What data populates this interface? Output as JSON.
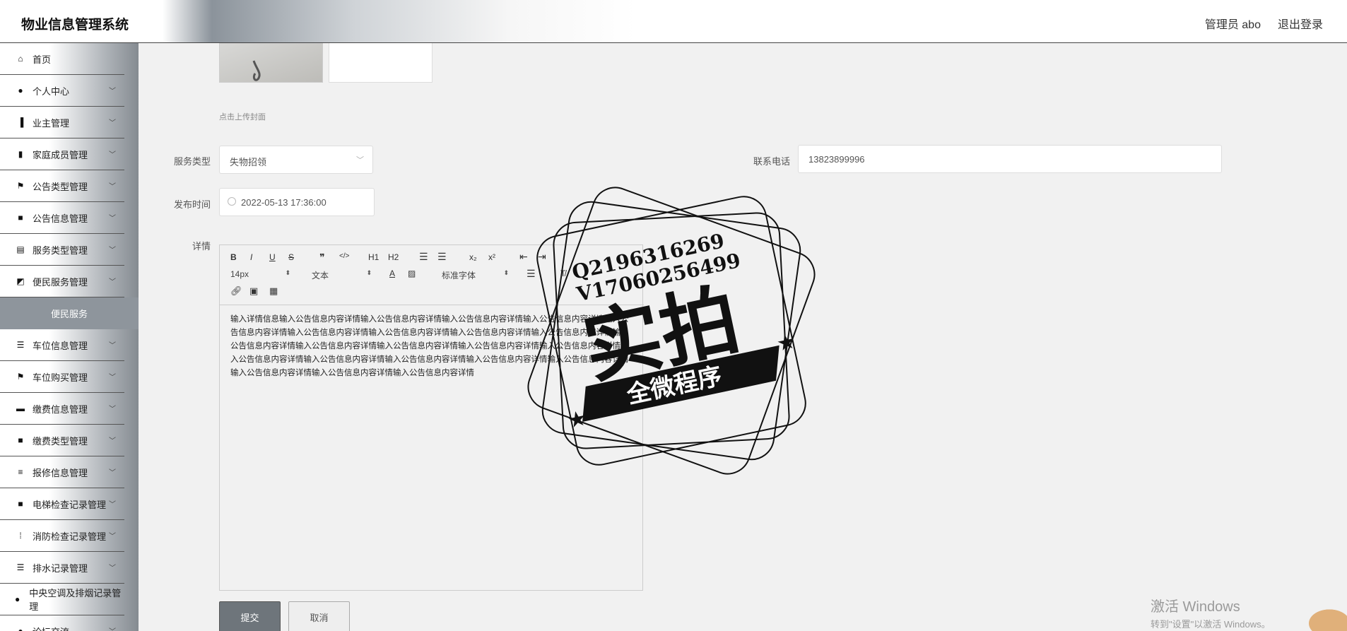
{
  "header": {
    "title": "物业信息管理系统",
    "user": "管理员 abo",
    "logout": "退出登录"
  },
  "sidebar": {
    "items": [
      {
        "label": "首页",
        "icon": "home-icon"
      },
      {
        "label": "个人中心",
        "icon": "user-icon"
      },
      {
        "label": "业主管理",
        "icon": "building-icon"
      },
      {
        "label": "家庭成员管理",
        "icon": "bar-chart-icon"
      },
      {
        "label": "公告类型管理",
        "icon": "flag-icon"
      },
      {
        "label": "公告信息管理",
        "icon": "grid-icon"
      },
      {
        "label": "服务类型管理",
        "icon": "clipboard-icon"
      },
      {
        "label": "便民服务管理",
        "icon": "chart-icon"
      },
      {
        "label": "便民服务",
        "icon": ""
      },
      {
        "label": "车位信息管理",
        "icon": "list-icon"
      },
      {
        "label": "车位购买管理",
        "icon": "flag-icon"
      },
      {
        "label": "缴费信息管理",
        "icon": "ticket-icon"
      },
      {
        "label": "缴费类型管理",
        "icon": "grid-icon"
      },
      {
        "label": "报修信息管理",
        "icon": "sliders-icon"
      },
      {
        "label": "电梯检查记录管理",
        "icon": "grid-icon"
      },
      {
        "label": "消防检查记录管理",
        "icon": "dots-grid-icon"
      },
      {
        "label": "排水记录管理",
        "icon": "list-icon"
      },
      {
        "label": "中央空调及排烟记录管理",
        "icon": "pin-icon"
      },
      {
        "label": "论坛交流",
        "icon": "user-icon"
      }
    ]
  },
  "form": {
    "upload_hint": "点击上传封面",
    "service_type": {
      "label": "服务类型",
      "value": "失物招领"
    },
    "phone": {
      "label": "联系电话",
      "value": "13823899996"
    },
    "publish_time": {
      "label": "发布时间",
      "value": "2022-05-13 17:36:00"
    },
    "detail": {
      "label": "详情"
    }
  },
  "editor": {
    "toolbar": {
      "bold": "B",
      "italic": "I",
      "underline": "U",
      "strike": "S",
      "quote": "❞",
      "code": "</>",
      "h1": "H1",
      "h2": "H2",
      "sub": "x₂",
      "sup": "x²",
      "font_size": "14px",
      "block_type": "文本",
      "font_family": "标准字体"
    },
    "content": "输入详情信息输入公告信息内容详情输入公告信息内容详情输入公告信息内容详情输入公告信息内容详情输入公告信息内容详情输入公告信息内容详情输入公告信息内容详情输入公告信息内容详情输入公告信息内容详情输入公告信息内容详情输入公告信息内容详情输入公告信息内容详情输入公告信息内容详情输入公告信息内容详情输入公告信息内容详情输入公告信息内容详情输入公告信息内容详情输入公告信息内容详情输入公告信息内容详情输入公告信息内容详情输入公告信息内容详情输入公告信息内容详情"
  },
  "buttons": {
    "submit": "提交",
    "cancel": "取消"
  },
  "watermark": {
    "line1": "Q2196316269",
    "line2": "V17060256499",
    "main": "实拍",
    "ribbon": "全微程序"
  },
  "windows": {
    "line1": "激活 Windows",
    "line2": "转到\"设置\"以激活 Windows。"
  }
}
